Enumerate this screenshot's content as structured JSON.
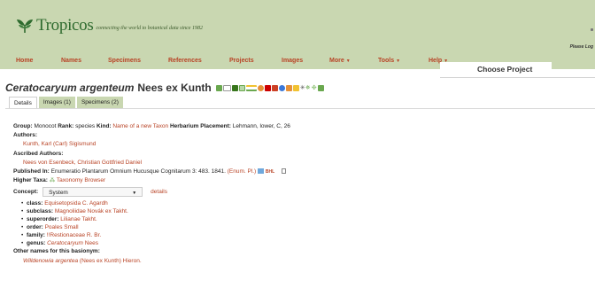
{
  "header": {
    "logo_text": "Tropicos",
    "tagline": "connecting the world to botanical data since 1982",
    "login_text": "Please Log",
    "nav": [
      {
        "label": "Home",
        "has_menu": false
      },
      {
        "label": "Names",
        "has_menu": false
      },
      {
        "label": "Specimens",
        "has_menu": false
      },
      {
        "label": "References",
        "has_menu": false
      },
      {
        "label": "Projects",
        "has_menu": false
      },
      {
        "label": "Images",
        "has_menu": false
      },
      {
        "label": "More",
        "has_menu": true
      },
      {
        "label": "Tools",
        "has_menu": true
      },
      {
        "label": "Help",
        "has_menu": true
      }
    ],
    "choose_project": "Choose Project"
  },
  "title": {
    "name": "Ceratocaryum argenteum",
    "author": "Nees ex Kunth"
  },
  "tabs": [
    {
      "label": "Details",
      "active": true
    },
    {
      "label": "Images (1)",
      "active": false
    },
    {
      "label": "Specimens (2)",
      "active": false
    }
  ],
  "details": {
    "group_label": "Group:",
    "group_value": "Monocot",
    "rank_label": "Rank:",
    "rank_value": "species",
    "kind_label": "Kind:",
    "kind_value": "Name of a new Taxon",
    "herbarium_label": "Herbarium Placement:",
    "herbarium_value": "Lehmann, lower, C, 26",
    "authors_label": "Authors:",
    "authors_value": "Kunth, Karl (Carl) Sigismund",
    "ascribed_label": "Ascribed Authors:",
    "ascribed_value": "Nees von Esenbeck, Christian Gottfried Daniel",
    "published_label": "Published In:",
    "published_value": "Enumeratio Plantarum Omnium Hucusque Cognitarum 3: 483. 1841.",
    "published_abbrev": "(Enum. Pl.)",
    "bhl_label": "BHL",
    "higher_taxa_label": "Higher Taxa:",
    "higher_taxa_link": "Taxonomy Browser",
    "concept_label": "Concept:",
    "concept_value": "System",
    "concept_details": "details",
    "hierarchy": [
      {
        "rank": "class:",
        "name": "Equisetopsida C. Agardh",
        "italic": false
      },
      {
        "rank": "subclass:",
        "name": "Magnoliidae Novák ex Takht.",
        "italic": false
      },
      {
        "rank": "superorder:",
        "name": "Lilianae Takht.",
        "italic": false
      },
      {
        "rank": "order:",
        "name": "Poales Small",
        "italic": false
      },
      {
        "rank": "family:",
        "name": "!!Restionaceae R. Br.",
        "italic": false
      },
      {
        "rank": "genus:",
        "name": "Ceratocaryum",
        "author": "Nees",
        "italic": true
      }
    ],
    "other_names_label": "Other names for this basionym:",
    "other_name_italic": "Willdenowia argentea",
    "other_name_rest": "(Nees ex Kunth) Hieron."
  },
  "colors": {
    "header_bg": "#c9d7b1",
    "link": "#b84224",
    "logo": "#2f6b2f"
  }
}
